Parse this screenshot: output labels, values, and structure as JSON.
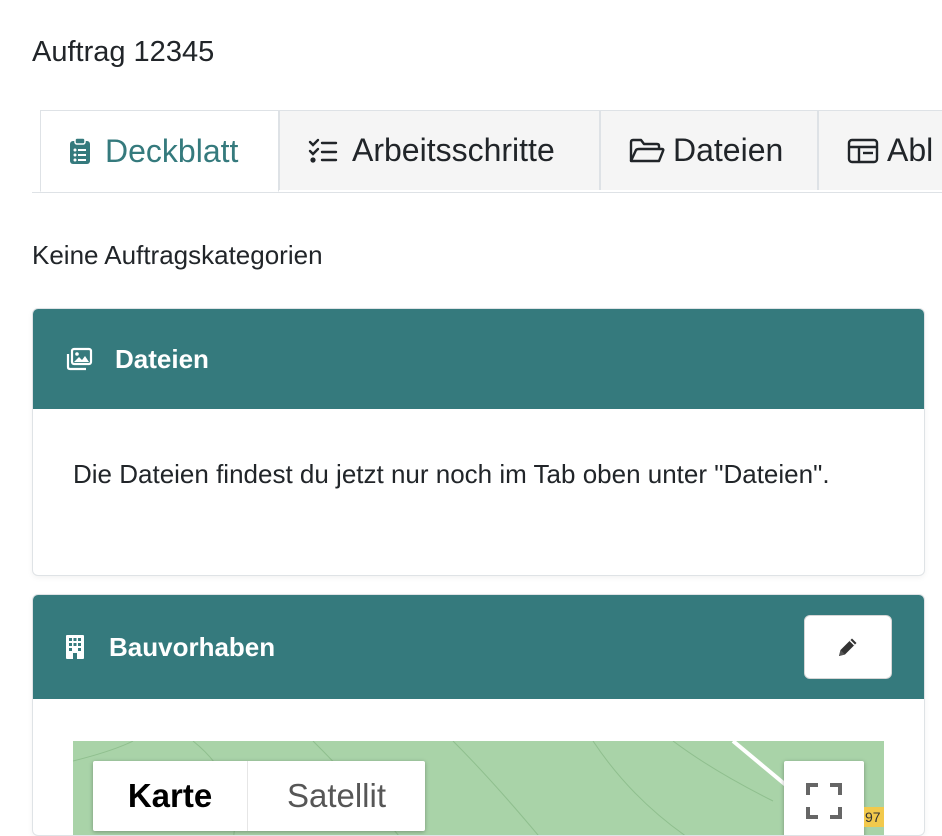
{
  "page": {
    "title": "Auftrag 12345"
  },
  "tabs": [
    {
      "label": "Deckblatt",
      "icon": "clipboard-list-icon",
      "active": true
    },
    {
      "label": "Arbeitsschritte",
      "icon": "checklist-icon",
      "active": false
    },
    {
      "label": "Dateien",
      "icon": "folder-open-icon",
      "active": false
    },
    {
      "label": "Abl",
      "icon": "panel-icon",
      "active": false
    }
  ],
  "categories": {
    "empty_text": "Keine Auftragskategorien"
  },
  "files_card": {
    "title": "Dateien",
    "icon": "images-icon",
    "body": "Die Dateien findest du jetzt nur noch im Tab oben unter \"Dateien\"."
  },
  "project_card": {
    "title": "Bauvorhaben",
    "icon": "building-icon",
    "edit_icon": "pencil-icon"
  },
  "map": {
    "type_options": [
      "Karte",
      "Satellit"
    ],
    "selected_type": "Karte",
    "fullscreen_icon": "fullscreen-icon",
    "road_number": "97"
  },
  "colors": {
    "accent": "#357a7d",
    "tab_inactive_bg": "#f5f5f5",
    "map_green": "#a9d3a8"
  }
}
